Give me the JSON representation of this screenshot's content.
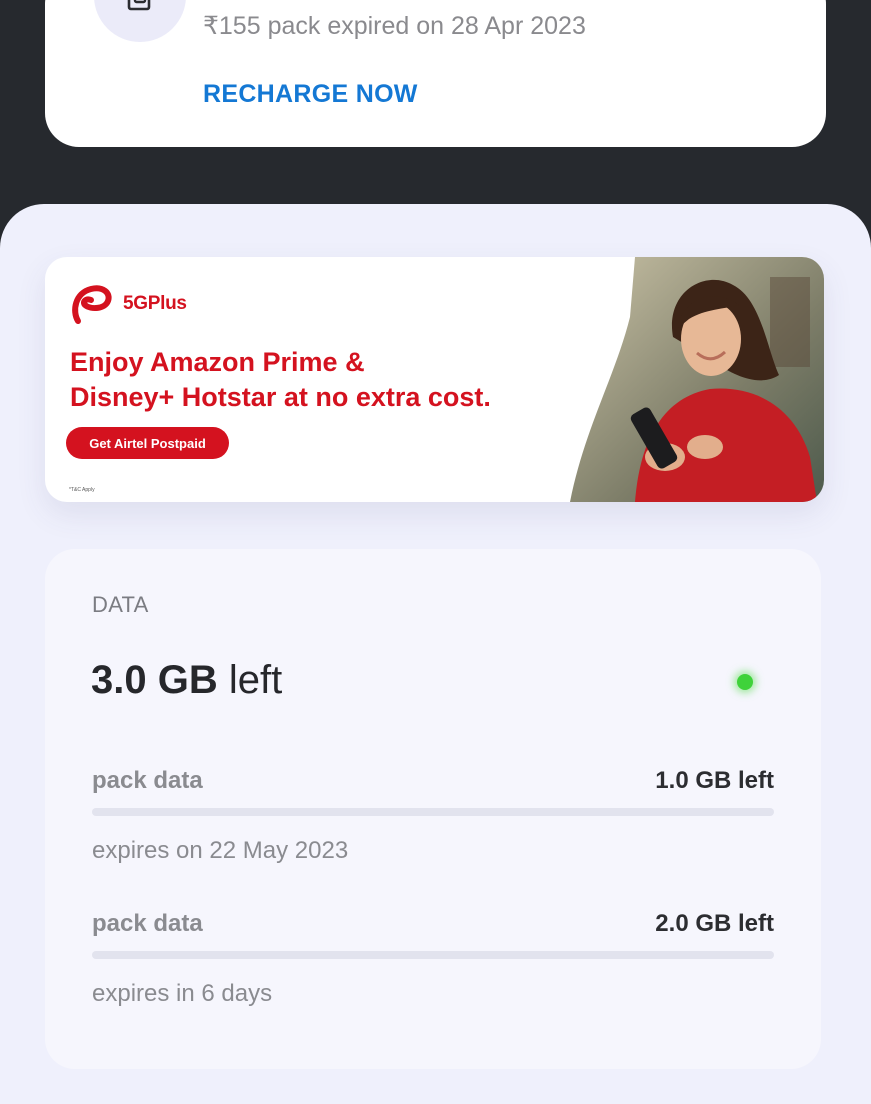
{
  "top_card": {
    "expired_text": "₹155 pack expired on 28 Apr 2023",
    "recharge_label": "RECHARGE NOW",
    "sim_icon": "sim-card-icon"
  },
  "banner": {
    "brand": "5GPlus",
    "brand_icon": "airtel-logo-icon",
    "headline_line1": "Enjoy Amazon Prime &",
    "headline_line2": "Disney+ Hotstar at no extra cost.",
    "cta_label": "Get Airtel Postpaid",
    "tnc": "*T&C Apply",
    "brand_color": "#d4121f"
  },
  "data_card": {
    "section_label": "DATA",
    "total_amount": "3.0 GB",
    "total_suffix": " left",
    "status_color": "#3fd23a",
    "packs": [
      {
        "name": "pack data",
        "left": "1.0 GB left",
        "expiry": "expires on 22 May 2023"
      },
      {
        "name": "pack data",
        "left": "2.0 GB left",
        "expiry": "expires in 6 days"
      }
    ]
  }
}
